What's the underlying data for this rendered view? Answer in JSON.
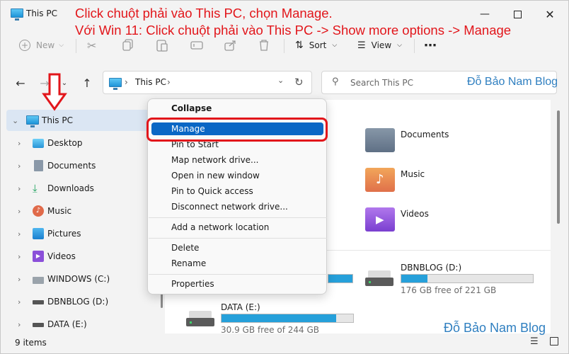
{
  "window": {
    "title": "This PC"
  },
  "annotation": {
    "line1": "Click chuột phải vào This PC, chọn Manage.",
    "line2": "Với Win 11: Click chuột phải vào This PC -> Show more options -> Manage",
    "color": "#e2161b"
  },
  "ribbon": {
    "new_label": "New",
    "sort_label": "Sort",
    "view_label": "View"
  },
  "address": {
    "crumb": "This PC"
  },
  "search": {
    "placeholder": "Search This PC"
  },
  "watermark": {
    "top": "Đỗ Bảo Nam Blog",
    "bottom": "Đỗ Bảo Nam Blog"
  },
  "sidebar": {
    "items": [
      {
        "label": "This PC",
        "icon": "pc-icon"
      },
      {
        "label": "Desktop",
        "icon": "desktop-icon"
      },
      {
        "label": "Documents",
        "icon": "documents-icon"
      },
      {
        "label": "Downloads",
        "icon": "download-icon"
      },
      {
        "label": "Music",
        "icon": "music-icon"
      },
      {
        "label": "Pictures",
        "icon": "pictures-icon"
      },
      {
        "label": "Videos",
        "icon": "videos-icon"
      },
      {
        "label": "WINDOWS (C:)",
        "icon": "windows-drive-icon"
      },
      {
        "label": "DBNBLOG (D:)",
        "icon": "drive-icon"
      },
      {
        "label": "DATA (E:)",
        "icon": "drive-icon"
      }
    ]
  },
  "content": {
    "folders": [
      {
        "label": "Documents"
      },
      {
        "label": "Music"
      },
      {
        "label": "Videos"
      }
    ],
    "drives": [
      {
        "label": "DBNBLOG (D:)",
        "free": "176 GB free of 221 GB",
        "used_fraction": 0.2
      },
      {
        "label": "DATA (E:)",
        "free": "30.9 GB free of 244 GB",
        "used_fraction": 0.87
      }
    ]
  },
  "context_menu": {
    "items": [
      "Collapse",
      "Manage",
      "Pin to Start",
      "Map network drive...",
      "Open in new window",
      "Pin to Quick access",
      "Disconnect network drive...",
      "Add a network location",
      "Delete",
      "Rename",
      "Properties"
    ]
  },
  "status": {
    "count": "9 items"
  },
  "colors": {
    "accent": "#0a67c5",
    "selection": "#dbe6f3",
    "drive_fill": "#26a0da"
  }
}
